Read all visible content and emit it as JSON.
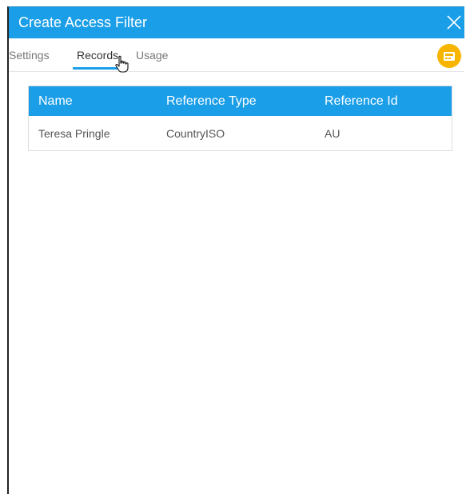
{
  "dialog": {
    "title": "Create Access Filter",
    "accent_color": "#1a9ee8",
    "fab_color": "#f7b500"
  },
  "tabs": [
    {
      "label": "Settings",
      "active": false
    },
    {
      "label": "Records",
      "active": true
    },
    {
      "label": "Usage",
      "active": false
    }
  ],
  "table": {
    "headers": [
      "Name",
      "Reference Type",
      "Reference Id"
    ],
    "rows": [
      [
        "Teresa Pringle",
        "CountryISO",
        "AU"
      ]
    ]
  },
  "icons": {
    "close": "close-icon",
    "fab": "save-icon",
    "cursor": "hand-pointer-cursor"
  }
}
